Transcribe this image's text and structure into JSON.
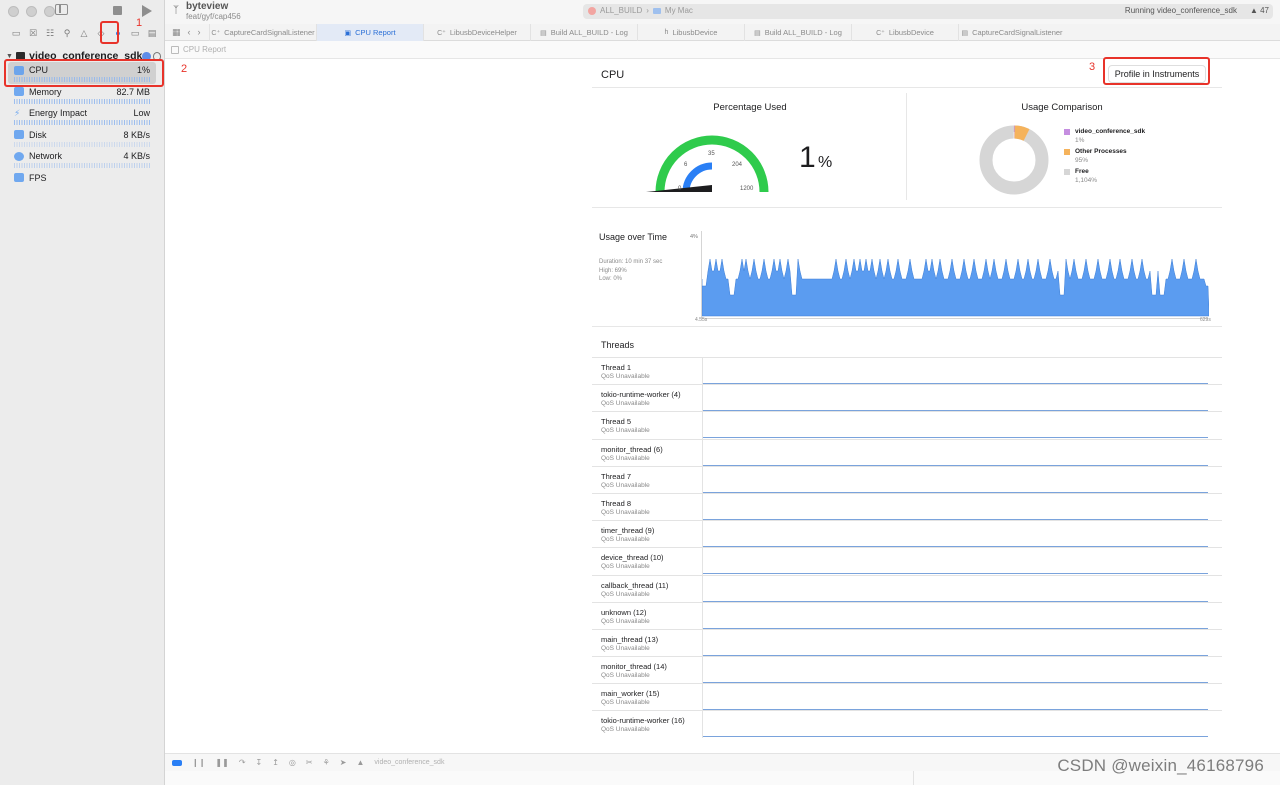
{
  "toolbar": {
    "project": "byteview",
    "branch": "feat/gyf/cap456",
    "scheme": "ALL_BUILD",
    "device": "My Mac",
    "status": "Running video_conference_sdk",
    "warnings": "47"
  },
  "tabs": [
    {
      "label": "CaptureCardSignalListener",
      "icon": "C++"
    },
    {
      "label": "CPU Report",
      "icon": "gauge"
    },
    {
      "label": "LibusbDeviceHelper",
      "icon": "C++"
    },
    {
      "label": "Build ALL_BUILD - Log",
      "icon": "doc"
    },
    {
      "label": "LibusbDevice",
      "icon": "h"
    },
    {
      "label": "Build ALL_BUILD - Log",
      "icon": "doc"
    },
    {
      "label": "LibusbDevice",
      "icon": "C++"
    },
    {
      "label": "CaptureCardSignalListener",
      "icon": "doc"
    }
  ],
  "jump_bar": "CPU Report",
  "annotations": {
    "one": "1",
    "two": "2",
    "three": "3"
  },
  "sidebar": {
    "process": "video_conference_sdk",
    "gauges": [
      {
        "name": "CPU",
        "value": "1%"
      },
      {
        "name": "Memory",
        "value": "82.7 MB"
      },
      {
        "name": "Energy Impact",
        "value": "Low"
      },
      {
        "name": "Disk",
        "value": "8 KB/s"
      },
      {
        "name": "Network",
        "value": "4 KB/s"
      },
      {
        "name": "FPS",
        "value": ""
      }
    ]
  },
  "report": {
    "title": "CPU",
    "profile_button": "Profile in Instruments",
    "percentage_used": {
      "title": "Percentage Used",
      "value": "1",
      "unit": "%",
      "ticks": [
        "0",
        "6",
        "35",
        "204",
        "1200"
      ]
    },
    "usage_comparison": {
      "title": "Usage Comparison",
      "legend": [
        {
          "name": "video_conference_sdk",
          "value": "1%",
          "color": "#c58ee0"
        },
        {
          "name": "Other Processes",
          "value": "95%",
          "color": "#f5b35c"
        },
        {
          "name": "Free",
          "value": "1,104%",
          "color": "#d6d6d6"
        }
      ]
    },
    "usage_over_time": {
      "title": "Usage over Time",
      "duration": "Duration: 10 min 37 sec",
      "high": "High: 69%",
      "low": "Low: 0%",
      "y_top": "4%",
      "x_start": "4.55s",
      "x_end": "629s"
    },
    "threads_title": "Threads",
    "threads": [
      {
        "name": "Thread 1",
        "qos": "QoS Unavailable"
      },
      {
        "name": "tokio-runtime-worker (4)",
        "qos": "QoS Unavailable"
      },
      {
        "name": "Thread 5",
        "qos": "QoS Unavailable"
      },
      {
        "name": "monitor_thread (6)",
        "qos": "QoS Unavailable"
      },
      {
        "name": "Thread 7",
        "qos": "QoS Unavailable"
      },
      {
        "name": "Thread 8",
        "qos": "QoS Unavailable"
      },
      {
        "name": "timer_thread (9)",
        "qos": "QoS Unavailable"
      },
      {
        "name": "device_thread (10)",
        "qos": "QoS Unavailable"
      },
      {
        "name": "callback_thread (11)",
        "qos": "QoS Unavailable"
      },
      {
        "name": "unknown (12)",
        "qos": "QoS Unavailable"
      },
      {
        "name": "main_thread (13)",
        "qos": "QoS Unavailable"
      },
      {
        "name": "monitor_thread (14)",
        "qos": "QoS Unavailable"
      },
      {
        "name": "main_worker (15)",
        "qos": "QoS Unavailable"
      },
      {
        "name": "tokio-runtime-worker (16)",
        "qos": "QoS Unavailable"
      }
    ]
  },
  "bottom_bar": {
    "target": "video_conference_sdk"
  },
  "watermark": "CSDN @weixin_46168796",
  "colors": {
    "accent": "#2a7ff5",
    "gauge_green": "#2fcb4c",
    "gauge_blue": "#2a7ff5",
    "chart_fill": "#5b9cf0",
    "annotation_red": "#e8332a"
  }
}
